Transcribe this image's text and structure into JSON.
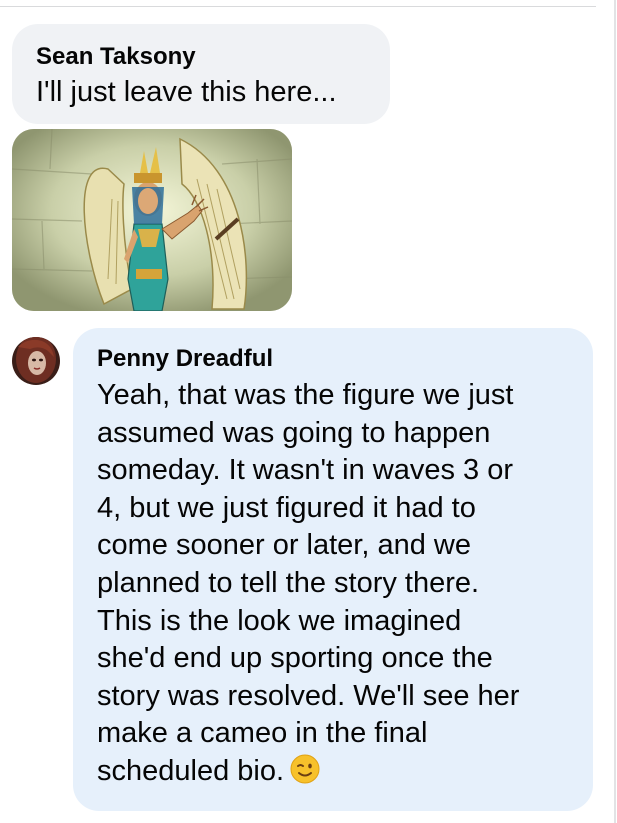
{
  "comments": [
    {
      "author": "Sean Taksony",
      "text": "I'll just leave this here...",
      "attachment": {
        "icon": "winged-egyptian-figure-image"
      }
    },
    {
      "author": "Penny Dreadful",
      "avatar": {
        "icon": "user-avatar-photo"
      },
      "text": "Yeah, that was the figure we just\nassumed was going to happen\nsomeday. It wasn't in waves 3 or\n4, but we just figured it had to\ncome sooner or later, and we\nplanned to tell the story there.\nThis is the look we imagined\nshe'd end up sporting once the\nstory was resolved. We'll see her\nmake a cameo in the final\nscheduled bio.",
      "emoji": "winking-face-emoji"
    }
  ],
  "colors": {
    "bubble_gray": "#f0f2f5",
    "bubble_blue": "#e6f0fb",
    "text": "#050505"
  }
}
